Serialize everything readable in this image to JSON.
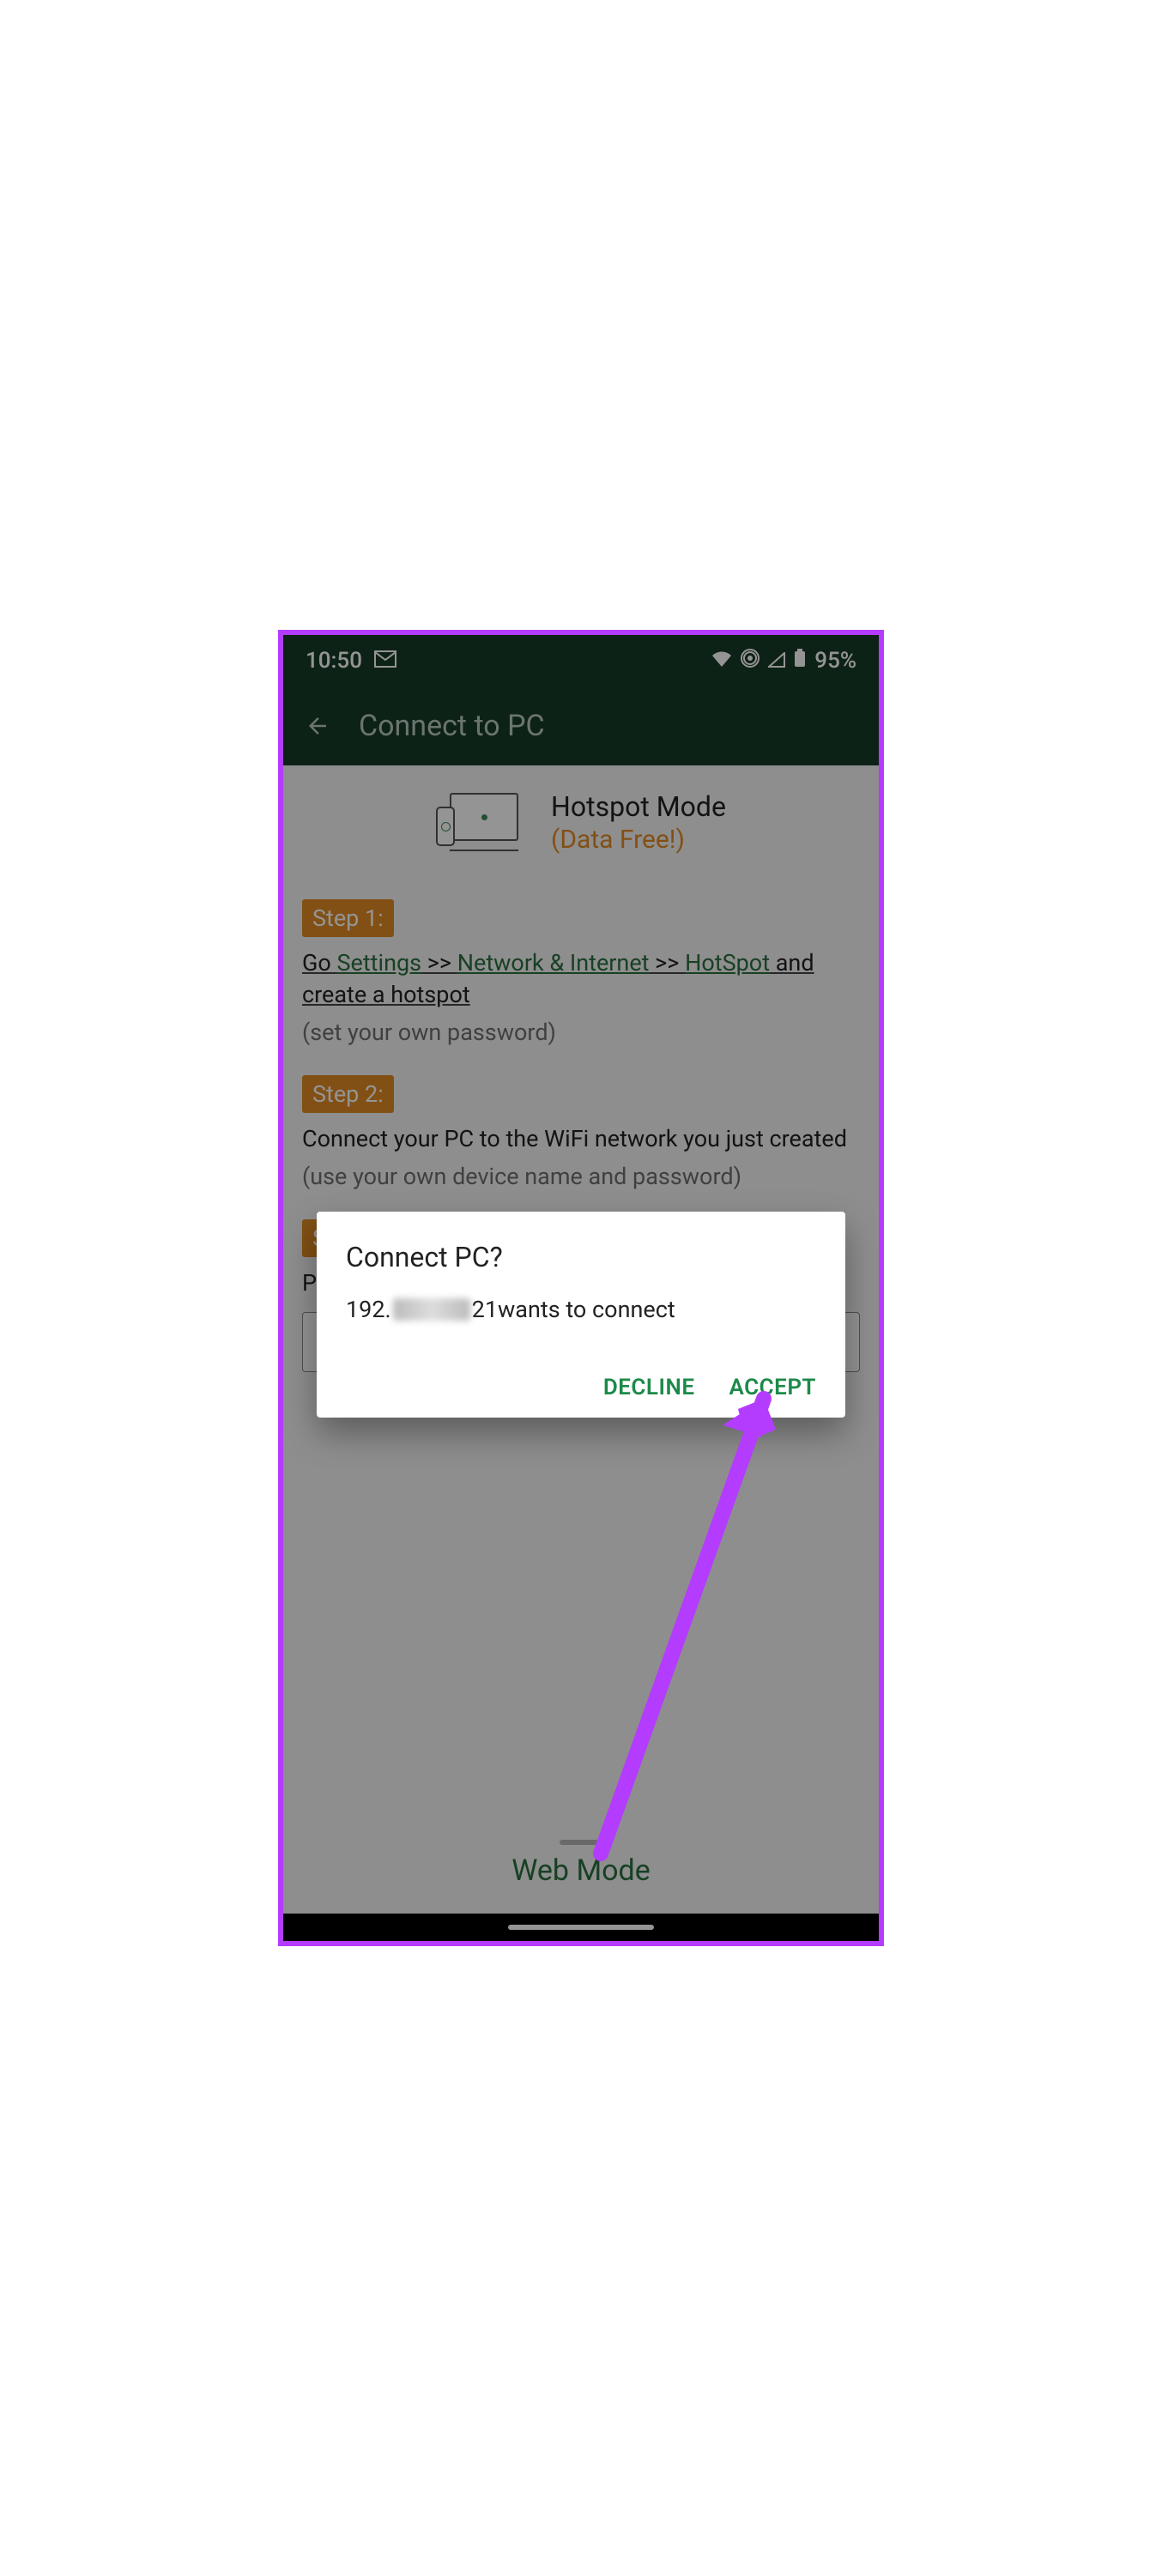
{
  "statusbar": {
    "time": "10:50",
    "battery_pct": "95%"
  },
  "appbar": {
    "title": "Connect to PC"
  },
  "mode": {
    "title": "Hotspot Mode",
    "subtitle": "(Data Free!)"
  },
  "steps": {
    "s1": {
      "label": "Step 1:",
      "prefix": "Go ",
      "link_settings": "Settings",
      "sep1": " >> ",
      "link_network": "Network & Internet",
      "sep2": " >> ",
      "link_hotspot": "HotSpot",
      "suffix": " and create a hotspot",
      "hint": "(set your own password)"
    },
    "s2": {
      "label": "Step 2:",
      "main": "Connect your PC to the WiFi network you just created",
      "hint": "(use your own device name and password)"
    },
    "s3": {
      "label": "Step 3:",
      "main_truncated": "P"
    }
  },
  "web_mode_label": "Web Mode",
  "dialog": {
    "title": "Connect PC?",
    "ip_prefix": "192.",
    "ip_suffix": "21",
    "msg_suffix": " wants to connect",
    "decline": "DECLINE",
    "accept": "ACCEPT"
  }
}
